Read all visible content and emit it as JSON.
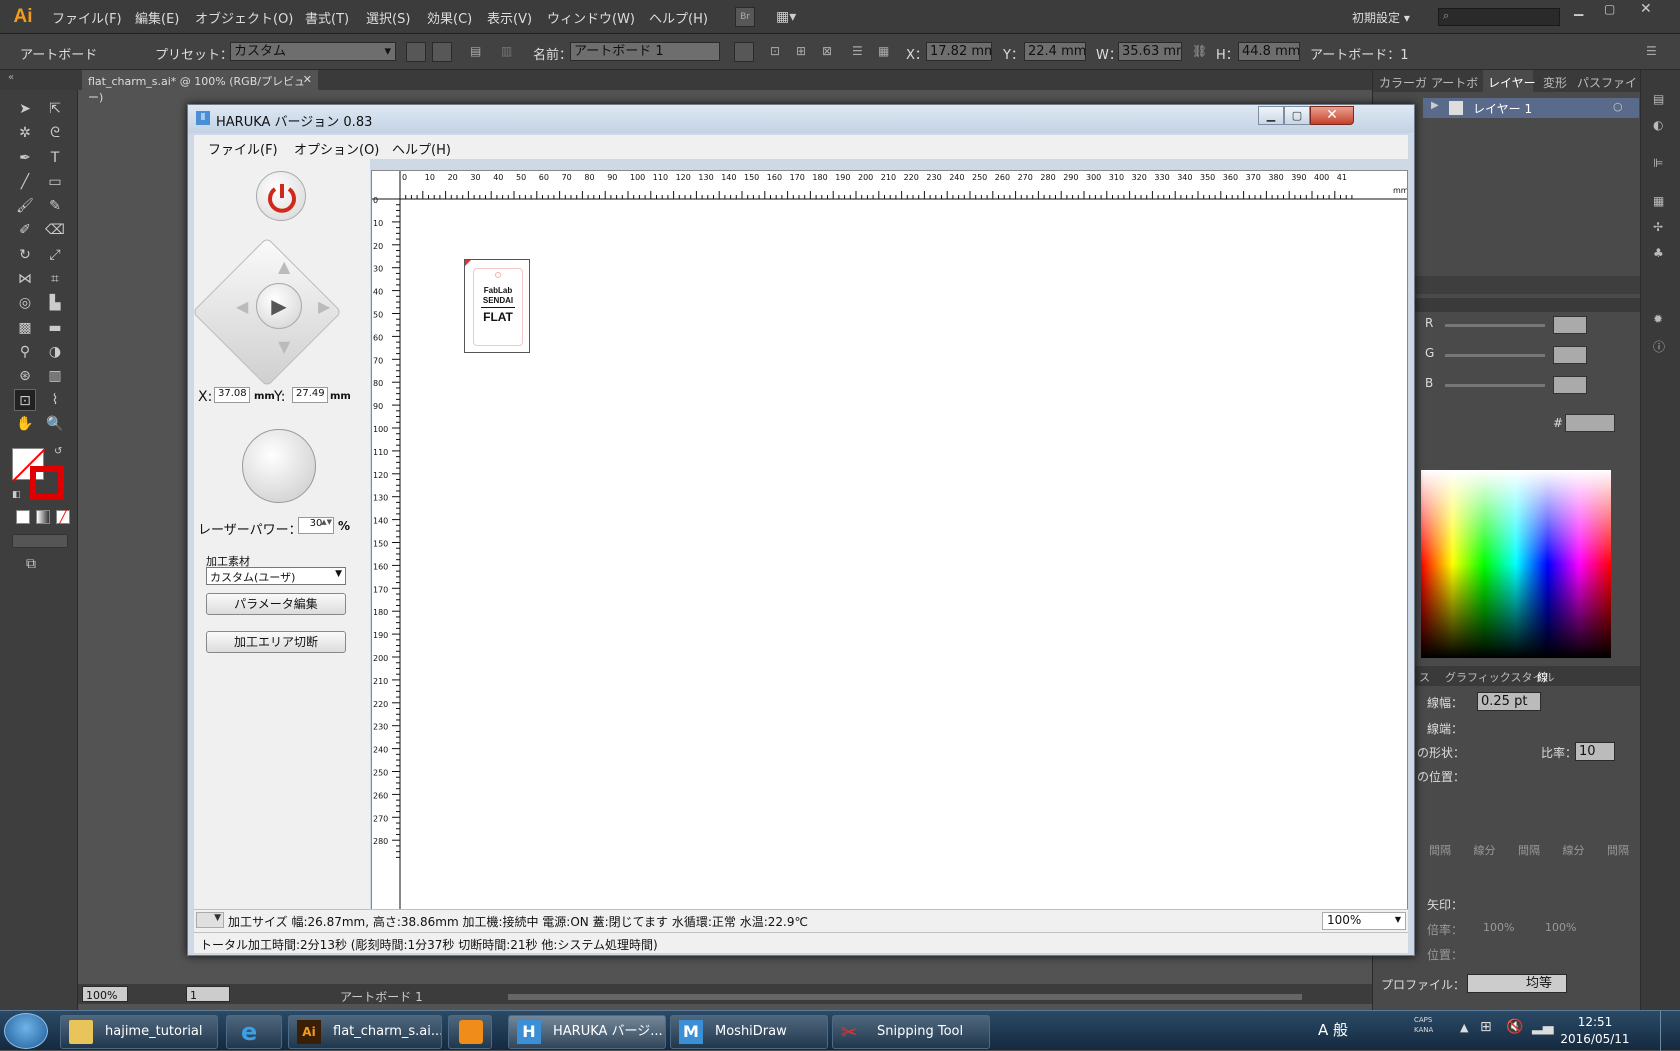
{
  "app": {
    "logo": "Ai",
    "workspace": "初期設定"
  },
  "menu": [
    "ファイル(F)",
    "編集(E)",
    "オブジェクト(O)",
    "書式(T)",
    "選択(S)",
    "効果(C)",
    "表示(V)",
    "ウィンドウ(W)",
    "ヘルプ(H)"
  ],
  "control": {
    "artboard_label": "アートボード",
    "preset_label": "プリセット：",
    "preset_value": "カスタム",
    "name_label": "名前：",
    "name_value": "アートボード 1",
    "x_label": "X：",
    "x_value": "17.82 mm",
    "y_label": "Y：",
    "y_value": "22.4 mm",
    "w_label": "W：",
    "w_value": "35.63 mm",
    "h_label": "H：",
    "h_value": "44.8 mm",
    "artboard_count": "アートボード：1"
  },
  "document_tab": "flat_charm_s.ai* @ 100% (RGB/プレビュー)",
  "panels": {
    "tabs": [
      "カラーガ",
      "アートボ",
      "レイヤー",
      "変形",
      "パスファイ"
    ],
    "layer_name": "レイヤー 1",
    "layer_footer": "ヤー",
    "rgb": [
      "R",
      "G",
      "B"
    ],
    "hash": "#",
    "stroke_tabs": [
      "ス",
      "グラフィックスタイル",
      "線"
    ],
    "stroke_weight_label": "線幅：",
    "stroke_weight": "0.25 pt",
    "cap_label": "線端：",
    "join_label": "の形状：",
    "ratio_label": "比率：",
    "ratio": "10",
    "align_label": "の位置：",
    "dash_labels": [
      "間隔",
      "線分",
      "間隔",
      "線分",
      "間隔"
    ],
    "arrow_label": "矢印：",
    "scale_label": "倍率：",
    "scale1": "100%",
    "scale2": "100%",
    "pos_label": "位置：",
    "profile_label": "プロファイル：",
    "profile_value": "均等"
  },
  "ai_status": {
    "zoom": "100%",
    "page": "1",
    "artboard": "アートボード 1"
  },
  "haruka": {
    "title": "HARUKA バージョン 0.83",
    "menu": [
      "ファイル(F)",
      "オプション(O)",
      "ヘルプ(H)"
    ],
    "x_label": "X:",
    "x_value": "37.08",
    "y_label": "Y:",
    "y_value": "27.49",
    "unit": "mm",
    "laser_label": "レーザーパワー：",
    "laser_value": "30",
    "percent": "%",
    "material_label": "加工素材",
    "material_value": "カスタム(ユーザ)",
    "param_button": "パラメータ編集",
    "cut_button": "加工エリア切断",
    "ruler_unit": "mm",
    "ruler_x": [
      "0",
      "10",
      "20",
      "30",
      "40",
      "50",
      "60",
      "70",
      "80",
      "90",
      "100",
      "110",
      "120",
      "130",
      "140",
      "150",
      "160",
      "170",
      "180",
      "190",
      "200",
      "210",
      "220",
      "230",
      "240",
      "250",
      "260",
      "270",
      "280",
      "290",
      "300",
      "310",
      "320",
      "330",
      "340",
      "350",
      "360",
      "370",
      "380",
      "390",
      "400",
      "41"
    ],
    "ruler_y": [
      "0",
      "10",
      "20",
      "30",
      "40",
      "50",
      "60",
      "70",
      "80",
      "90",
      "100",
      "110",
      "120",
      "130",
      "140",
      "150",
      "160",
      "170",
      "180",
      "190",
      "200",
      "210",
      "220",
      "230",
      "240",
      "250",
      "260",
      "270",
      "280"
    ],
    "status1": "加工サイズ 幅:26.87mm, 高さ:38.86mm  加工機:接続中  電源:ON  蓋:閉じてます  水循環:正常  水温:22.9℃",
    "zoom": "100%",
    "status2": "トータル加工時間:2分13秒 (彫刻時間:1分37秒 切断時間:21秒 他:システム処理時間)",
    "charm_line1": "FabLab",
    "charm_line2": "SENDAI",
    "charm_line3": "FLAT"
  },
  "taskbar": {
    "items": [
      "hajime_tutorial",
      "",
      "flat_charm_s.ai...",
      "",
      "HARUKA バージ...",
      "MoshiDraw",
      "Snipping Tool"
    ],
    "ime": "A 般",
    "caps": "CAPS",
    "kana": "KANA",
    "time": "12:51",
    "date": "2016/05/11"
  }
}
